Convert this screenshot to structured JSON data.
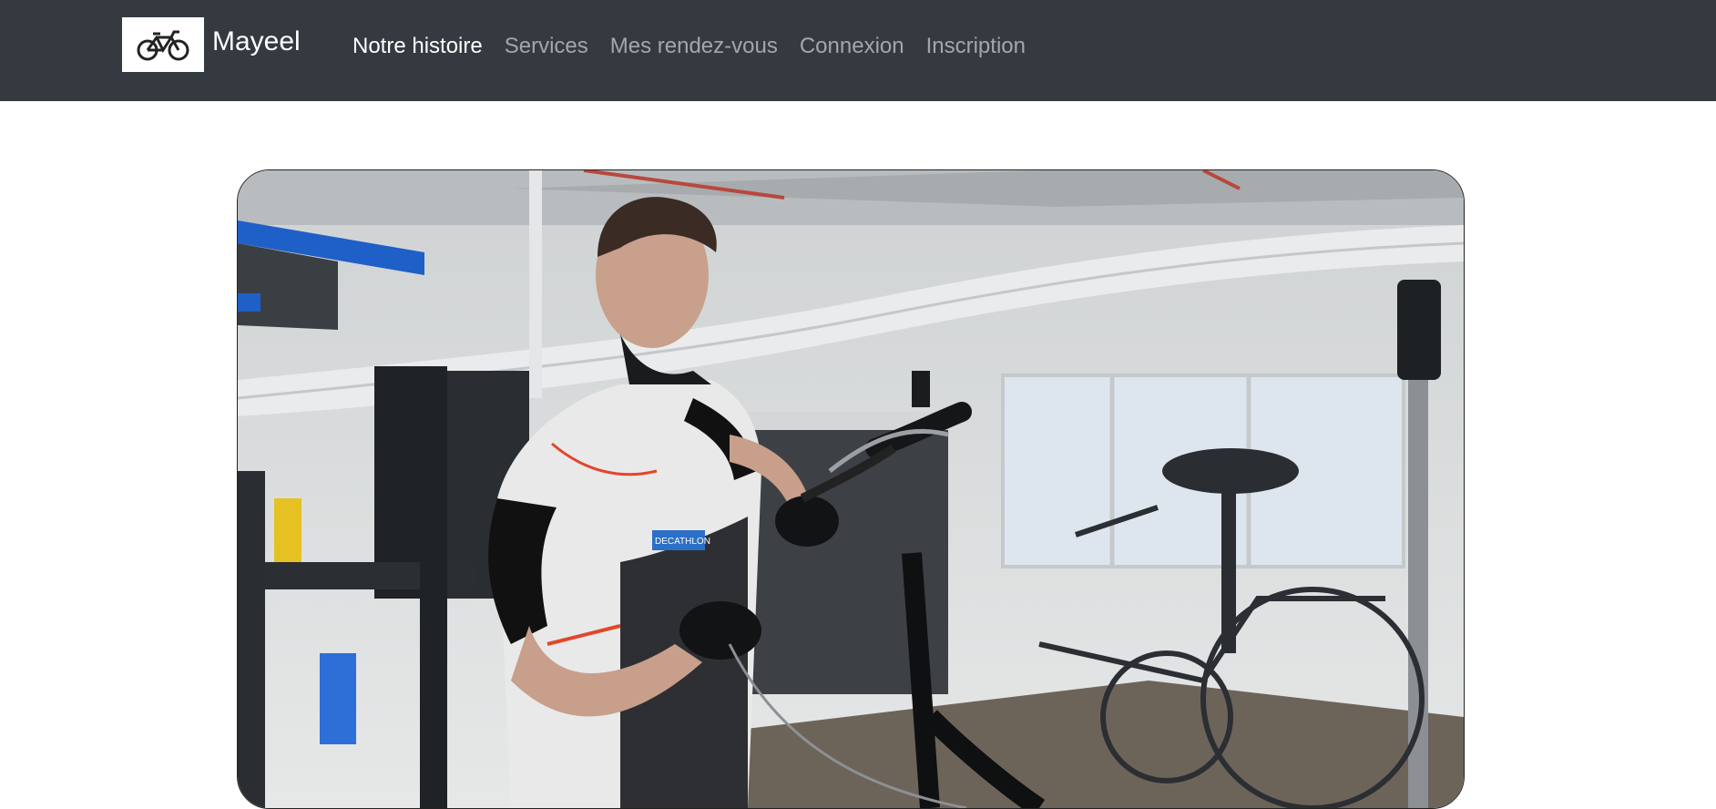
{
  "navbar": {
    "brand": {
      "name": "Mayeel",
      "logo_icon": "bicycle-icon"
    },
    "links": [
      {
        "label": "Notre histoire",
        "active": true
      },
      {
        "label": "Services",
        "active": false
      },
      {
        "label": "Mes rendez-vous",
        "active": false
      },
      {
        "label": "Connexion",
        "active": false
      },
      {
        "label": "Inscription",
        "active": false
      }
    ],
    "colors": {
      "background": "#343a40",
      "active_link": "#ffffff",
      "inactive_link": "rgba(255,255,255,0.55)"
    }
  },
  "hero": {
    "image_text": {
      "vest_badge": "DECATHLON"
    }
  }
}
